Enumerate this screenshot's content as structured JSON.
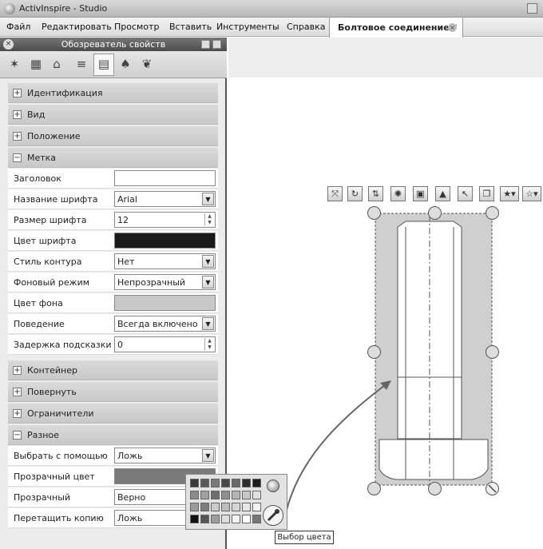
{
  "window": {
    "title": "ActivInspire - Studio"
  },
  "menu": [
    "Файл",
    "Редактировать",
    "Просмотр",
    "Вставить",
    "Инструменты",
    "Справка"
  ],
  "document_tab": {
    "label": "Болтовое соединение *"
  },
  "panel": {
    "title": "Обозреватель свойств",
    "tab_icons": [
      "actions-icon",
      "film-icon",
      "browser-icon",
      "notes-icon",
      "properties-icon",
      "pin-icon",
      "brush-icon"
    ],
    "sections": [
      {
        "label": "Идентификация"
      },
      {
        "label": "Вид"
      },
      {
        "label": "Положение"
      },
      {
        "label": "Метка",
        "expanded": true,
        "props": [
          {
            "label": "Заголовок",
            "value": "",
            "control": "text"
          },
          {
            "label": "Название шрифта",
            "value": "Arial",
            "control": "dropdown"
          },
          {
            "label": "Размер шрифта",
            "value": "12",
            "control": "spin"
          },
          {
            "label": "Цвет шрифта",
            "value": "",
            "control": "color",
            "color": "#1a1a1a"
          },
          {
            "label": "Стиль контура",
            "value": "Нет",
            "control": "dropdown"
          },
          {
            "label": "Фоновый режим",
            "value": "Непрозрачный",
            "control": "dropdown"
          },
          {
            "label": "Цвет фона",
            "value": "",
            "control": "color",
            "color": "#c8c8c8"
          },
          {
            "label": "Поведение",
            "value": "Всегда включено",
            "control": "dropdown"
          },
          {
            "label": "Задержка подсказки (мс",
            "value": "0",
            "control": "spin"
          }
        ]
      },
      {
        "label": "Контейнер"
      },
      {
        "label": "Повернуть"
      },
      {
        "label": "Ограничители"
      },
      {
        "label": "Разное",
        "expanded": true,
        "props": [
          {
            "label": "Выбрать с помощью",
            "value": "Ложь",
            "control": "dropdown"
          },
          {
            "label": "Прозрачный цвет",
            "value": "",
            "control": "color",
            "color": "#7a7a7a"
          },
          {
            "label": "Прозрачный",
            "value": "Верно",
            "control": "dropdown"
          },
          {
            "label": "Перетащить копию",
            "value": "Ложь",
            "control": "dropdown"
          }
        ]
      }
    ]
  },
  "object_toolbar": [
    "resize-icon",
    "rotate-icon",
    "flip-icon",
    "grid-icon",
    "layer-icon",
    "translator-icon",
    "edit-points-icon",
    "duplicate-icon",
    "favorite-icon",
    "more-icon"
  ],
  "palette": {
    "colors": [
      "#3a3a3a",
      "#5a5a5a",
      "#7a7a7a",
      "#4a4a4a",
      "#6a6a6a",
      "#2e2e2e",
      "#1c1c1c",
      "#8a8a8a",
      "#a0a0a0",
      "#6d6d6d",
      "#909090",
      "#b5b5b5",
      "#c7c7c7",
      "#e0e0e0",
      "#9a9a9a",
      "#7e7e7e",
      "#cacaca",
      "#bdbdbd",
      "#d5d5d5",
      "#e8e8e8",
      "#f2f2f2",
      "#111111",
      "#555555",
      "#9e9e9e",
      "#dddddd",
      "#f6f6f6",
      "#ffffff",
      "#777777"
    ],
    "tooltip": "Выбор цвета"
  },
  "drawing": {
    "fill": "#cfcfcf"
  }
}
